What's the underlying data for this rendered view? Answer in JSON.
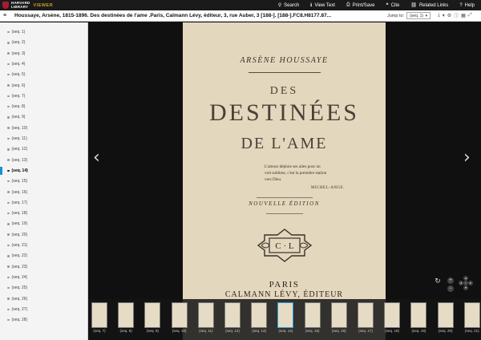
{
  "header": {
    "logo_line1": "HARVARD",
    "logo_line2": "LIBRARY",
    "viewer_label": "VIEWER",
    "nav": [
      {
        "icon": "search-icon",
        "glyph": "⚲",
        "label": "Search"
      },
      {
        "icon": "view-text-icon",
        "glyph": "ℹ",
        "label": "View Text"
      },
      {
        "icon": "print-icon",
        "glyph": "⎙",
        "label": "Print/Save"
      },
      {
        "icon": "cite-icon",
        "glyph": "❝",
        "label": "Cite"
      },
      {
        "icon": "related-links-icon",
        "glyph": "⛓",
        "label": "Related Links"
      },
      {
        "icon": "help-icon",
        "glyph": "?",
        "label": "Help"
      }
    ]
  },
  "titlebar": {
    "title": "Houssaye, Arsène, 1815-1896. Des destinées de l'ame .Paris, Calmann Lévy, éditeur, 3, rue Auber, 3 [188-]. [188-].FC8.H8177.87...",
    "jump_label": "Jump to:",
    "jump_value": "(seq. 1)"
  },
  "sidebar": {
    "items": [
      "(seq. 1)",
      "(seq. 2)",
      "(seq. 3)",
      "(seq. 4)",
      "(seq. 5)",
      "(seq. 6)",
      "(seq. 7)",
      "(seq. 8)",
      "(seq. 9)",
      "(seq. 10)",
      "(seq. 11)",
      "(seq. 12)",
      "(seq. 13)",
      "(seq. 14)",
      "(seq. 15)",
      "(seq. 16)",
      "(seq. 17)",
      "(seq. 18)",
      "(seq. 19)",
      "(seq. 20)",
      "(seq. 21)",
      "(seq. 22)",
      "(seq. 23)",
      "(seq. 24)",
      "(seq. 25)",
      "(seq. 26)",
      "(seq. 27)",
      "(seq. 28)"
    ],
    "active_index": 13
  },
  "page": {
    "author": "ARSÈNE HOUSSAYE",
    "line_des": "DES",
    "line_destinees": "DESTINÉES",
    "line_ame": "DE L'AME",
    "quote_1": "L'amour déploie ses ailes pour un",
    "quote_2": "voit sublime, c'est la première station",
    "quote_3": "vers Dieu.",
    "quote_sign": "MICHEL-ANGE.",
    "edition": "NOUVELLE ÉDITION",
    "logo_text": "C · L",
    "place": "PARIS",
    "publisher": "CALMANN LÉVY, ÉDITEUR"
  },
  "thumbnails": {
    "labels": [
      "(seq. 7)",
      "(seq. 8)",
      "(seq. 9)",
      "(seq. 10)",
      "(seq. 11)",
      "(seq. 12)",
      "(seq. 13)",
      "(seq. 14)",
      "(seq. 15)",
      "(seq. 16)",
      "(seq. 17)",
      "(seq. 18)",
      "(seq. 19)",
      "(seq. 20)",
      "(seq. 21)"
    ],
    "active_index": 7
  },
  "colors": {
    "accent": "#1a8fd6",
    "brand": "#a51c30",
    "viewer_gold": "#c9a227"
  }
}
